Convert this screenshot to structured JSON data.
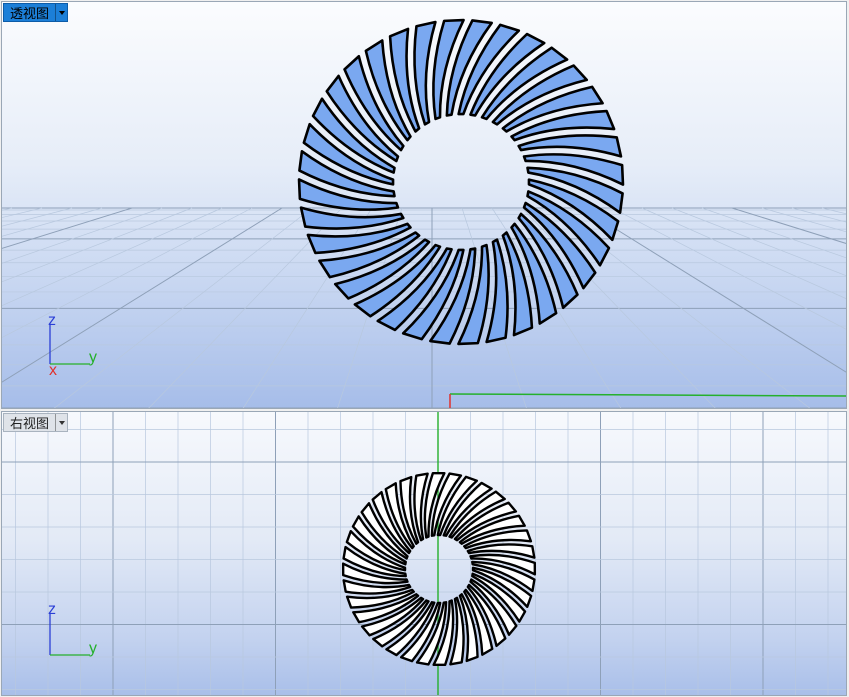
{
  "viewports": {
    "perspective": {
      "tab_label": "透视图",
      "axes": {
        "z": "z",
        "y": "y",
        "x": "x"
      }
    },
    "right": {
      "tab_label": "右视图",
      "axes": {
        "z": "z",
        "y": "y"
      }
    }
  },
  "colors": {
    "active_tab": "#1c7fd8",
    "fin_fill": "#7aa8f0",
    "fin_outline": "#000000",
    "axis_x": "#e0312c",
    "axis_y": "#25b02c",
    "axis_z": "#2b3fd6",
    "grid_minor": "#b8c8de",
    "grid_major": "#8ea0b8"
  },
  "model": {
    "fin_count": 36
  }
}
